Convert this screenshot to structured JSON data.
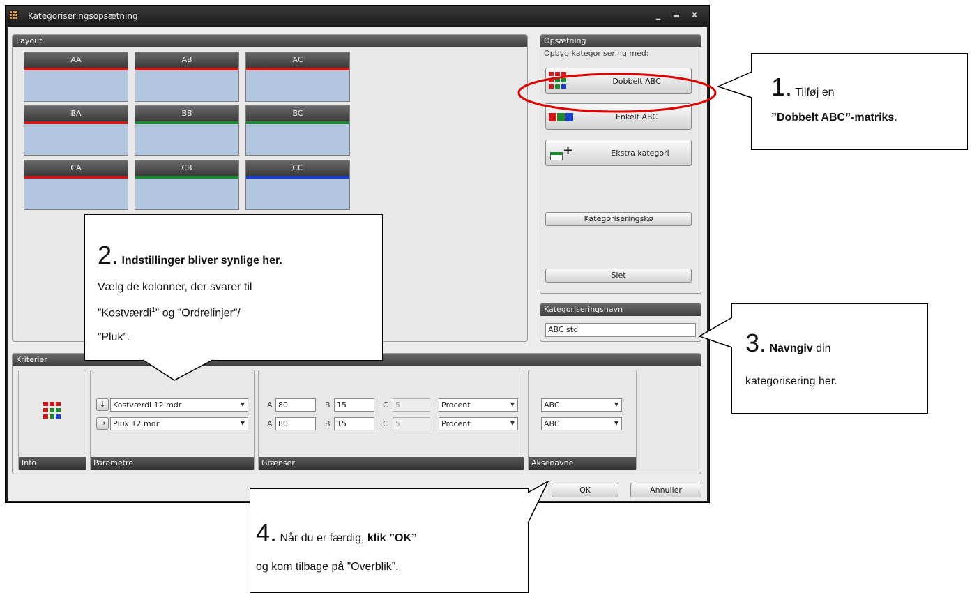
{
  "window": {
    "title": "Kategoriseringsopsætning"
  },
  "layout": {
    "title": "Layout",
    "tiles": [
      {
        "label": "AA",
        "bar": "#d01818"
      },
      {
        "label": "AB",
        "bar": "#d01818"
      },
      {
        "label": "AC",
        "bar": "#d01818"
      },
      {
        "label": "BA",
        "bar": "#d01818"
      },
      {
        "label": "BB",
        "bar": "#1e8a30"
      },
      {
        "label": "BC",
        "bar": "#1e8a30"
      },
      {
        "label": "CA",
        "bar": "#d01818"
      },
      {
        "label": "CB",
        "bar": "#1e8a30"
      },
      {
        "label": "CC",
        "bar": "#1a3fd0"
      }
    ]
  },
  "opsaetning": {
    "title": "Opsætning",
    "subtitle": "Opbyg kategorisering med:",
    "dobbelt": "Dobbelt ABC",
    "enkelt": "Enkelt ABC",
    "ekstra": "Ekstra kategori",
    "koe": "Kategoriseringskø",
    "slet": "Slet"
  },
  "navn": {
    "title": "Kategoriseringsnavn",
    "value": "ABC std"
  },
  "kriterier": {
    "title": "Kriterier",
    "info_label": "Info",
    "parametre_label": "Parametre",
    "graenser_label": "Grænser",
    "aksenavne_label": "Aksenavne",
    "row1": {
      "arrow": "↓",
      "column": "Kostværdi 12 mdr",
      "a_lbl": "A",
      "a": "80",
      "b_lbl": "B",
      "b": "15",
      "c_lbl": "C",
      "c": "5",
      "type": "Procent",
      "axis": "ABC"
    },
    "row2": {
      "arrow": "→",
      "column": "Pluk 12 mdr",
      "a_lbl": "A",
      "a": "80",
      "b_lbl": "B",
      "b": "15",
      "c_lbl": "C",
      "c": "5",
      "type": "Procent",
      "axis": "ABC"
    }
  },
  "footer": {
    "ok": "OK",
    "cancel": "Annuller"
  },
  "callouts": {
    "c1": {
      "num": "1.",
      "pre": " Tilføj en ",
      "bold": "”Dobbelt ABC”-matriks",
      "post": "."
    },
    "c2": {
      "num": "2.",
      "head": " Indstillinger bliver synlige her.",
      "line1": "Vælg de kolonner, der svarer til",
      "line2a": "”Kostværdi",
      "sup": "1",
      "line2b": "” og ”Ordrelinjer”/",
      "line3": "”Pluk”."
    },
    "c3": {
      "num": "3.",
      "bold": " Navngiv",
      "post": " din",
      "line2": "kategorisering her."
    },
    "c4": {
      "num": "4.",
      "pre": " Når du er færdig, ",
      "bold": "klik ”OK”",
      "line2": "og kom tilbage på ”Overblik”."
    }
  },
  "colors": {
    "highlight": "#e00000",
    "red": "#d01818",
    "green": "#1e8a30",
    "blue": "#1a3fd0"
  }
}
